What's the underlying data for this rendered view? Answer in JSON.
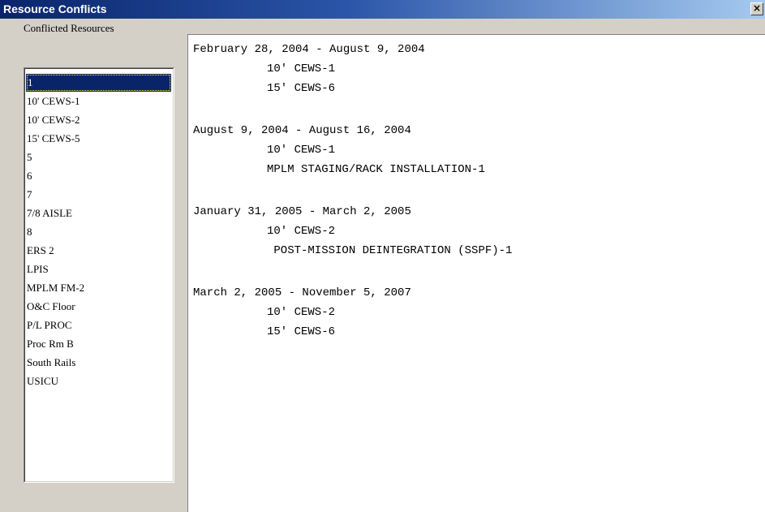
{
  "window": {
    "title": "Resource Conflicts",
    "close_label": "×"
  },
  "list": {
    "header": "Conflicted Resources",
    "items": [
      "1",
      "10' CEWS-1",
      "10' CEWS-2",
      "15' CEWS-5",
      "5",
      "6",
      "7",
      "7/8 AISLE",
      "8",
      "ERS 2",
      "LPIS",
      "MPLM FM-2",
      "O&C Floor",
      "P/L PROC",
      "Proc Rm B",
      "South Rails",
      "USICU"
    ],
    "selected_index": 0
  },
  "conflicts": [
    {
      "range": "February 28, 2004 - August 9, 2004",
      "resources": [
        "10' CEWS-1",
        "15' CEWS-6"
      ]
    },
    {
      "range": "August 9, 2004 - August 16, 2004",
      "resources": [
        "10' CEWS-1",
        "MPLM STAGING/RACK INSTALLATION-1"
      ]
    },
    {
      "range": "January 31, 2005 - March 2, 2005",
      "resources": [
        "10' CEWS-2",
        " POST-MISSION DEINTEGRATION (SSPF)-1"
      ]
    },
    {
      "range": "March 2, 2005 - November 5, 2007",
      "resources": [
        "10' CEWS-2",
        "15' CEWS-6"
      ]
    }
  ]
}
